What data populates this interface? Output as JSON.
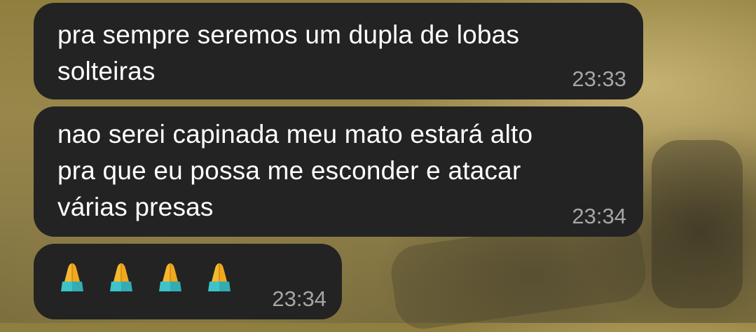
{
  "messages": [
    {
      "text": "pra sempre seremos um dupla de lobas\nsolteiras",
      "time": "23:33"
    },
    {
      "text": "nao serei capinada meu mato estará alto\npra que eu possa me esconder e atacar\nvárias presas",
      "time": "23:34"
    },
    {
      "emoji": "🙏🙏🙏🙏",
      "emoji_icon": "folded-hands-icon",
      "time": "23:34"
    }
  ],
  "colors": {
    "bubble": "#232323",
    "text": "#ffffff",
    "timestamp": "#a6a6a6",
    "emoji_skin": "#f5b82e",
    "emoji_cuff": "#3ec3c9"
  }
}
